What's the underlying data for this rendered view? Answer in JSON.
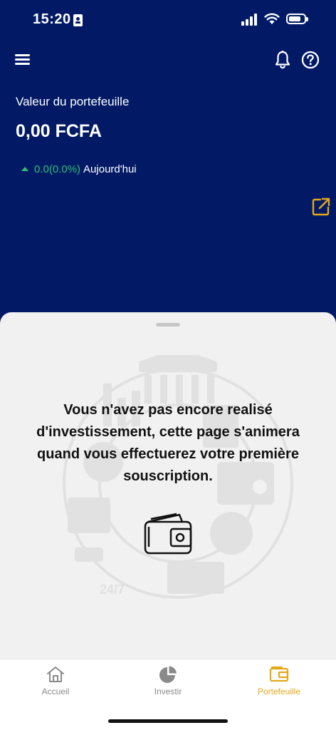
{
  "status_bar": {
    "time": "15:20"
  },
  "header": {
    "menu_icon": "hamburger-menu-icon",
    "notifications_icon": "bell-icon",
    "help_icon": "question-circle-icon"
  },
  "portfolio": {
    "label": "Valeur du portefeuille",
    "value": "0,00 FCFA",
    "change": "0.0(0.0%)",
    "period": "Aujourd'hui",
    "change_color": "#2fbf71",
    "external_link_icon": "external-link-icon"
  },
  "empty_state": {
    "message": "Vous n'avez pas encore realisé d'investissement, cette page s'animera quand vous effectuerez votre première souscription.",
    "icon": "wallet-icon"
  },
  "tabs": [
    {
      "label": "Accueil",
      "icon": "home-icon",
      "active": false
    },
    {
      "label": "Investir",
      "icon": "pie-chart-icon",
      "active": false
    },
    {
      "label": "Portefeuille",
      "icon": "wallet-icon",
      "active": true
    }
  ],
  "colors": {
    "header_bg": "#021a66",
    "accent": "#e3a81c",
    "positive": "#2fbf71",
    "inactive_tab": "#8a8a8a"
  }
}
